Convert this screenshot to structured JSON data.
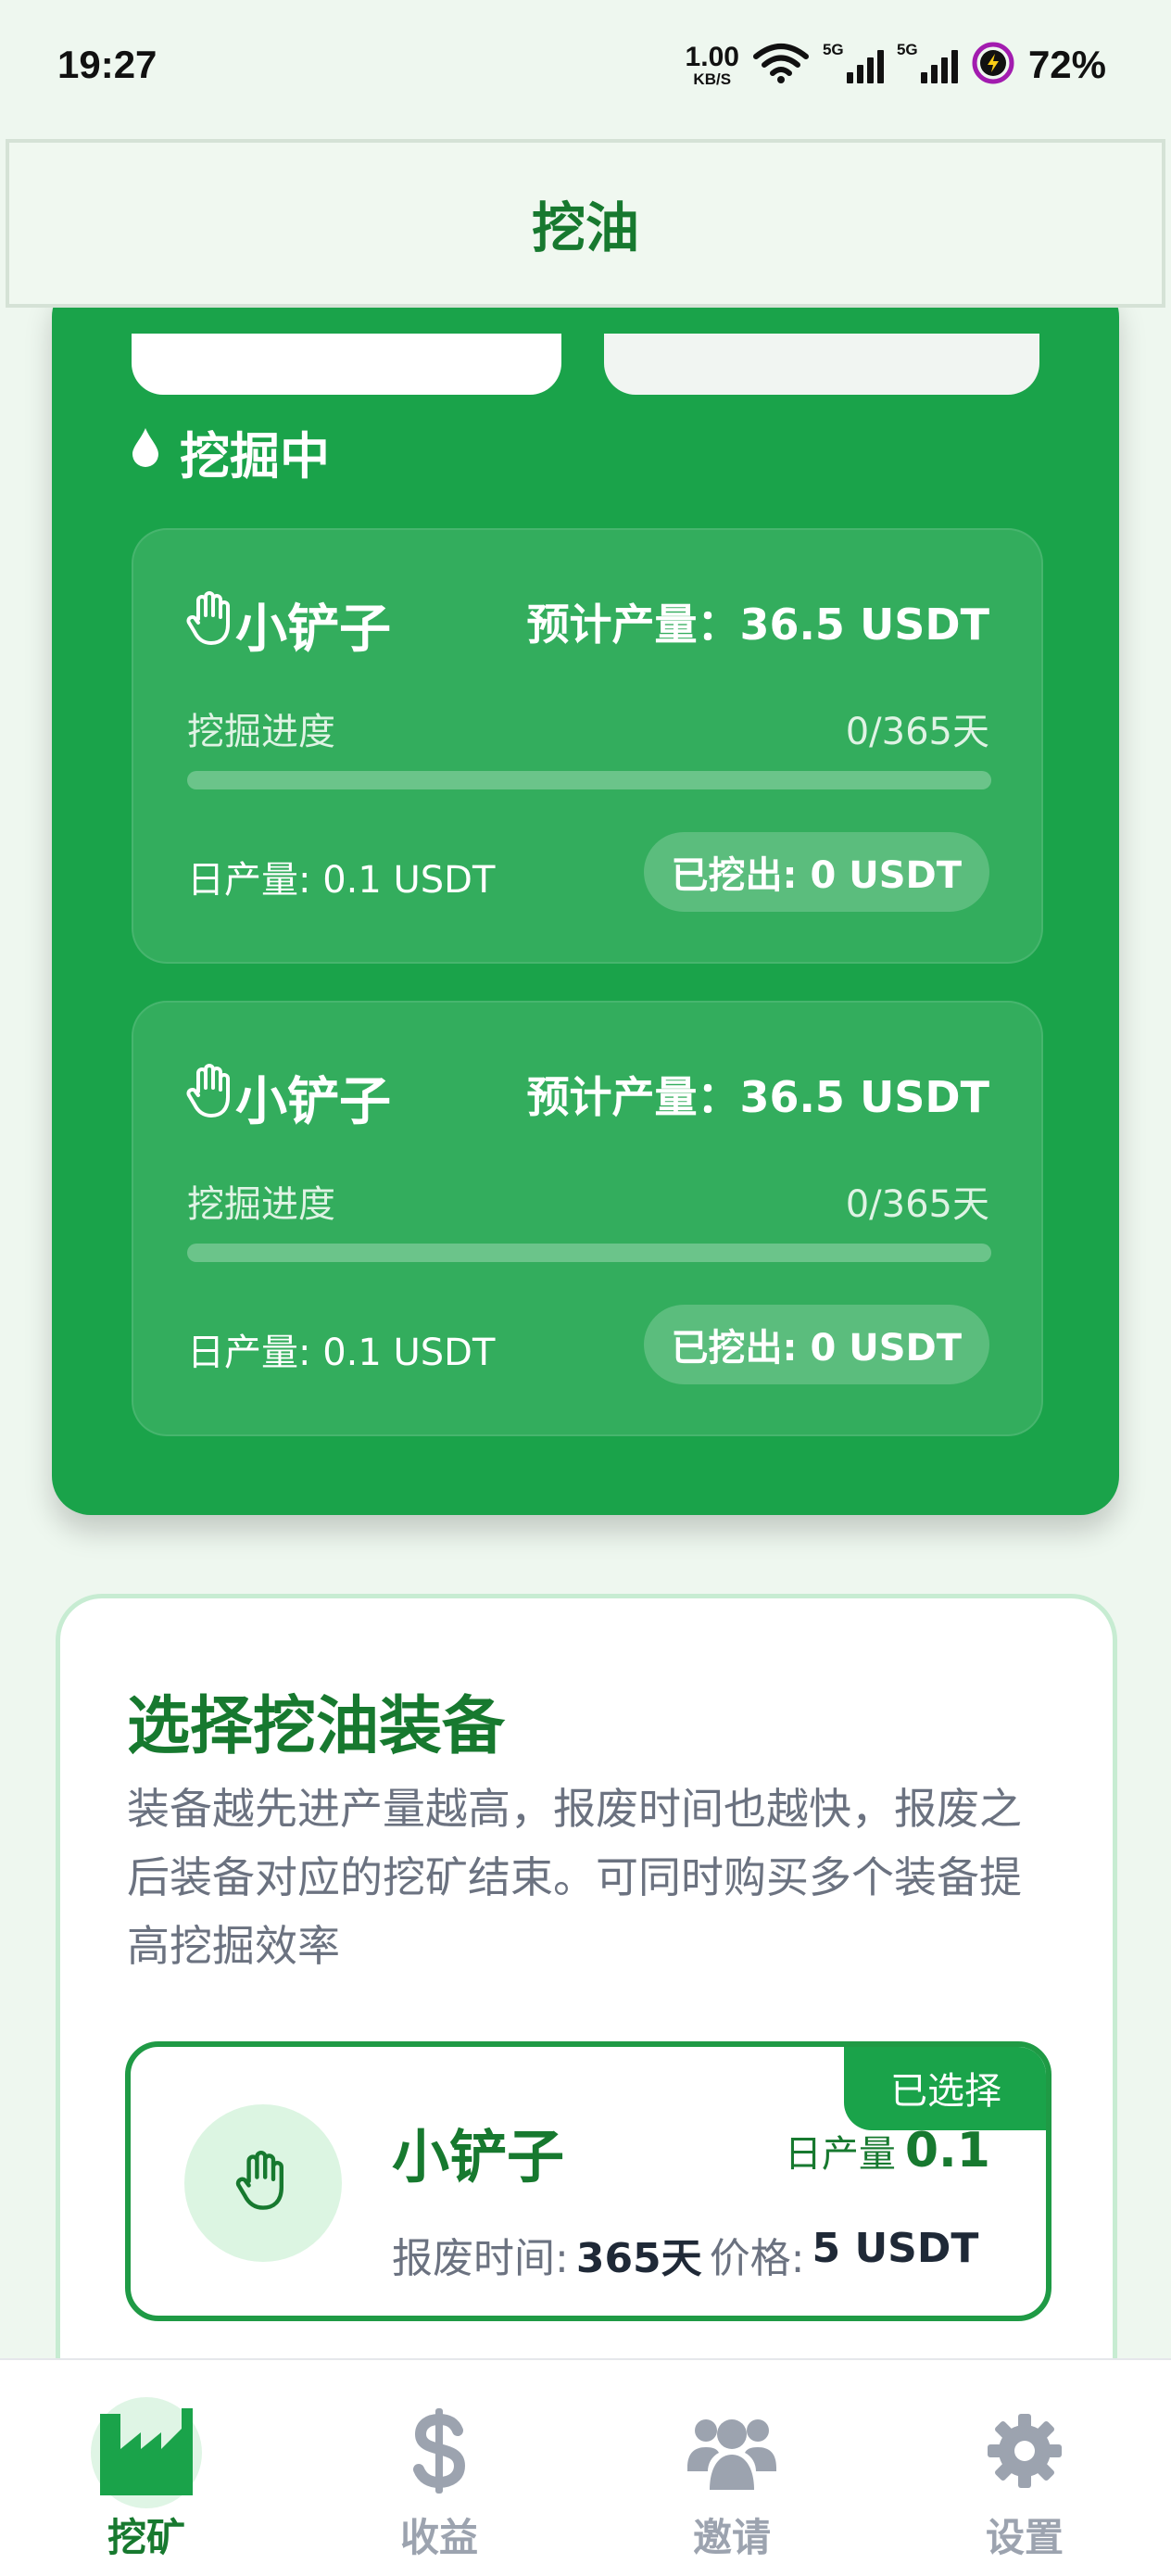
{
  "status_bar": {
    "time": "19:27",
    "speed_value": "1.00",
    "speed_unit": "KB/S",
    "network_1": "5G",
    "network_2": "5G",
    "battery": "72%"
  },
  "header": {
    "title": "挖油"
  },
  "mining": {
    "section_title": "挖掘中",
    "cards": [
      {
        "name": "小铲子",
        "estimate": "预计产量：36.5 USDT",
        "progress_label": "挖掘进度",
        "progress_text": "0/365天",
        "progress_fraction": 0,
        "daily": "日产量: 0.1 USDT",
        "mined": "已挖出: 0 USDT"
      },
      {
        "name": "小铲子",
        "estimate": "预计产量：36.5 USDT",
        "progress_label": "挖掘进度",
        "progress_text": "0/365天",
        "progress_fraction": 0,
        "daily": "日产量: 0.1 USDT",
        "mined": "已挖出: 0 USDT"
      }
    ]
  },
  "equipment": {
    "title": "选择挖油装备",
    "description": "装备越先进产量越高，报废时间也越快，报废之后装备对应的挖矿结束。可同时购买多个装备提高挖掘效率",
    "items": [
      {
        "name": "小铲子",
        "badge": "已选择",
        "daily_label": "日产量",
        "daily_value": "0.1",
        "scrap_label": "报废时间:",
        "scrap_value": "365天",
        "price_label": "价格:",
        "price_value": "5 USDT",
        "icon": "hand-icon"
      }
    ]
  },
  "nav": {
    "items": [
      {
        "label": "挖矿",
        "icon": "factory-icon",
        "active": true
      },
      {
        "label": "收益",
        "icon": "dollar-icon",
        "active": false
      },
      {
        "label": "邀请",
        "icon": "users-icon",
        "active": false
      },
      {
        "label": "设置",
        "icon": "gear-icon",
        "active": false
      }
    ]
  },
  "colors": {
    "primary": "#1aa34a",
    "primary_dark": "#17792f",
    "background": "#eef7ef"
  }
}
